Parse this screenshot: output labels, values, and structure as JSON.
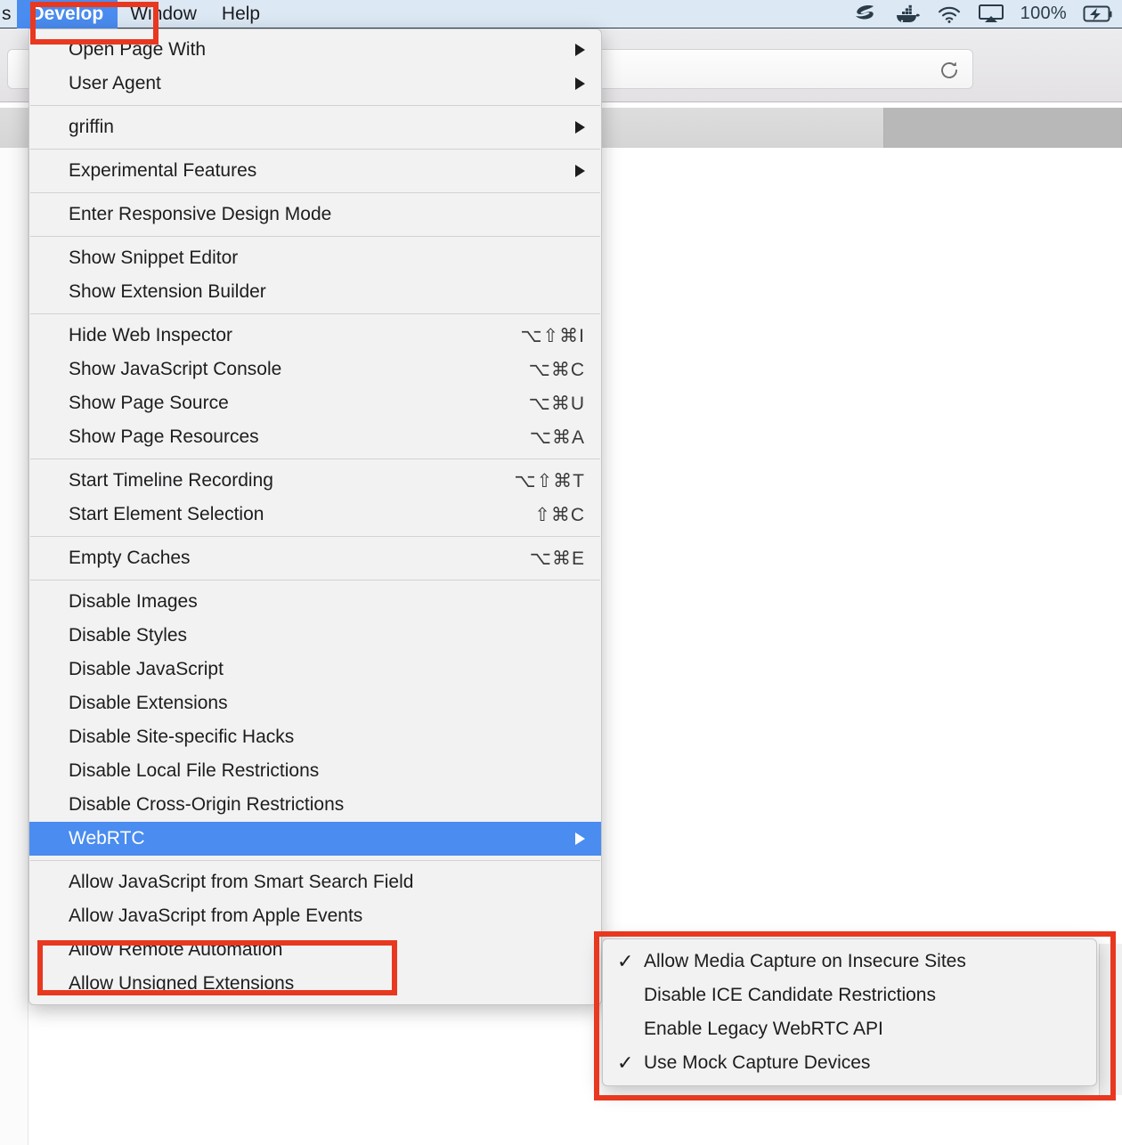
{
  "menubar": {
    "truncated_item": "s",
    "items": [
      {
        "label": "Develop",
        "active": true
      },
      {
        "label": "Window",
        "active": false
      },
      {
        "label": "Help",
        "active": false
      }
    ],
    "tray": {
      "icons": [
        "sequel-pro-icon",
        "docker-whale-icon",
        "wifi-icon",
        "airplay-icon"
      ],
      "battery_percent": "100%",
      "battery_icon": "battery-charging-icon"
    }
  },
  "browser": {
    "reload_icon": "reload-icon",
    "urlbar_value": "",
    "urlbar_placeholder": ""
  },
  "develop_menu": {
    "title": "Develop",
    "groups": [
      {
        "items": [
          {
            "label": "Open Page With",
            "submenu": true
          },
          {
            "label": "User Agent",
            "submenu": true
          }
        ]
      },
      {
        "items": [
          {
            "label": "griffin",
            "submenu": true
          }
        ]
      },
      {
        "items": [
          {
            "label": "Experimental Features",
            "submenu": true
          }
        ]
      },
      {
        "items": [
          {
            "label": "Enter Responsive Design Mode"
          }
        ]
      },
      {
        "items": [
          {
            "label": "Show Snippet Editor"
          },
          {
            "label": "Show Extension Builder"
          }
        ]
      },
      {
        "items": [
          {
            "label": "Hide Web Inspector",
            "shortcut": "⌥⇧⌘I"
          },
          {
            "label": "Show JavaScript Console",
            "shortcut": "⌥⌘C"
          },
          {
            "label": "Show Page Source",
            "shortcut": "⌥⌘U"
          },
          {
            "label": "Show Page Resources",
            "shortcut": "⌥⌘A"
          }
        ]
      },
      {
        "items": [
          {
            "label": "Start Timeline Recording",
            "shortcut": "⌥⇧⌘T"
          },
          {
            "label": "Start Element Selection",
            "shortcut": "⇧⌘C"
          }
        ]
      },
      {
        "items": [
          {
            "label": "Empty Caches",
            "shortcut": "⌥⌘E"
          }
        ]
      },
      {
        "items": [
          {
            "label": "Disable Images"
          },
          {
            "label": "Disable Styles"
          },
          {
            "label": "Disable JavaScript"
          },
          {
            "label": "Disable Extensions"
          },
          {
            "label": "Disable Site-specific Hacks"
          },
          {
            "label": "Disable Local File Restrictions"
          },
          {
            "label": "Disable Cross-Origin Restrictions"
          },
          {
            "label": "WebRTC",
            "submenu": true,
            "selected": true
          }
        ]
      },
      {
        "items": [
          {
            "label": "Allow JavaScript from Smart Search Field"
          },
          {
            "label": "Allow JavaScript from Apple Events"
          },
          {
            "label": "Allow Remote Automation"
          },
          {
            "label": "Allow Unsigned Extensions"
          }
        ]
      }
    ]
  },
  "webrtc_submenu": {
    "items": [
      {
        "label": "Allow Media Capture on Insecure Sites",
        "checked": true
      },
      {
        "label": "Disable ICE Candidate Restrictions",
        "checked": false
      },
      {
        "label": "Enable Legacy WebRTC API",
        "checked": false
      },
      {
        "label": "Use Mock Capture Devices",
        "checked": true
      }
    ]
  },
  "annotations": {
    "color": "#e8381f",
    "boxes": [
      "develop-menu-title",
      "webrtc-menu-item",
      "webrtc-submenu-panel"
    ]
  },
  "colors": {
    "menubar_bg": "#dce9f5",
    "menu_bg": "#f2f2f3",
    "highlight": "#4a8cf0",
    "annotation_red": "#e8381f",
    "text": "#1d1d1f"
  },
  "checkmark_glyph": "✓"
}
